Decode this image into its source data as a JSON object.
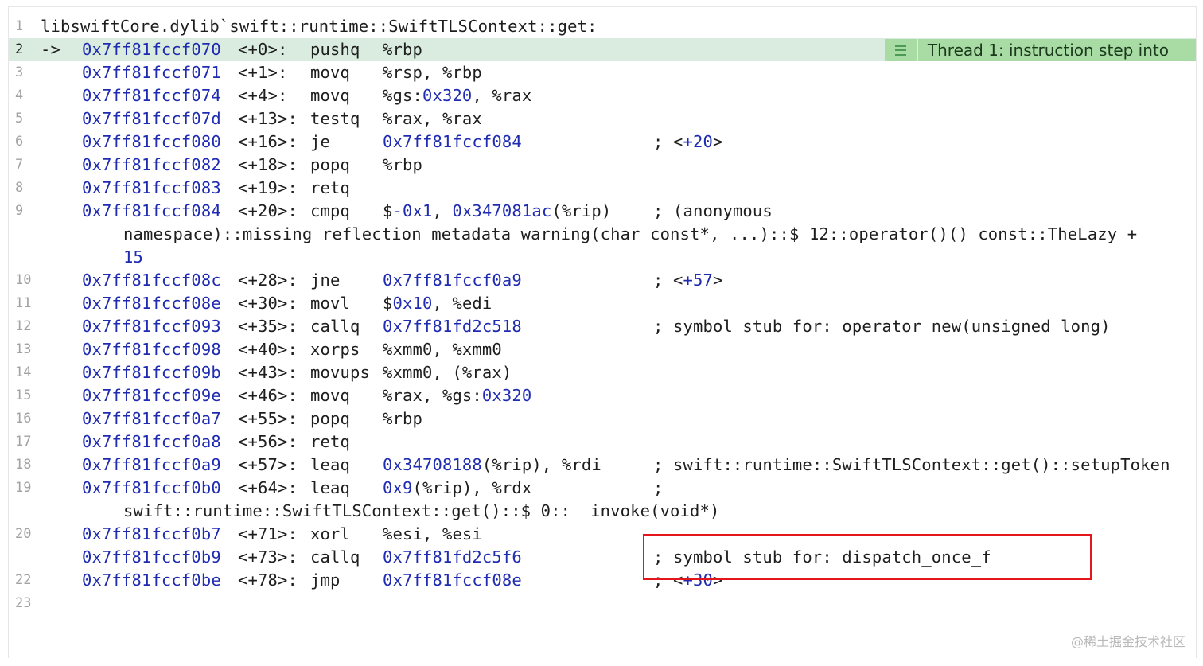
{
  "header": {
    "line_number": "1",
    "symbol": "libswiftCore.dylib`swift::runtime::SwiftTLSContext::get:"
  },
  "thread_badge": {
    "icon": "list-icon",
    "label": "Thread 1: instruction step into"
  },
  "pc_arrow": "->",
  "lines": [
    {
      "n": "2",
      "addr": "0x7ff81fccf070",
      "off": "<+0>:",
      "mn": "pushq",
      "ops": [
        {
          "t": "%rbp"
        }
      ]
    },
    {
      "n": "3",
      "addr": "0x7ff81fccf071",
      "off": "<+1>:",
      "mn": "movq",
      "ops": [
        {
          "t": "%rsp, %rbp"
        }
      ]
    },
    {
      "n": "4",
      "addr": "0x7ff81fccf074",
      "off": "<+4>:",
      "mn": "movq",
      "ops": [
        {
          "t": "%gs:"
        },
        {
          "t": "0x320",
          "hex": true
        },
        {
          "t": ", %rax"
        }
      ]
    },
    {
      "n": "5",
      "addr": "0x7ff81fccf07d",
      "off": "<+13>:",
      "mn": "testq",
      "ops": [
        {
          "t": "%rax, %rax"
        }
      ]
    },
    {
      "n": "6",
      "addr": "0x7ff81fccf080",
      "off": "<+16>:",
      "mn": "je",
      "ops": [
        {
          "t": "0x7ff81fccf084",
          "hex": true
        }
      ],
      "cmt": [
        {
          "t": "; <"
        },
        {
          "t": "+20",
          "hex": true
        },
        {
          "t": ">"
        }
      ]
    },
    {
      "n": "7",
      "addr": "0x7ff81fccf082",
      "off": "<+18>:",
      "mn": "popq",
      "ops": [
        {
          "t": "%rbp"
        }
      ]
    },
    {
      "n": "8",
      "addr": "0x7ff81fccf083",
      "off": "<+19>:",
      "mn": "retq",
      "ops": []
    },
    {
      "n": "9",
      "addr": "0x7ff81fccf084",
      "off": "<+20>:",
      "mn": "cmpq",
      "ops": [
        {
          "t": "$"
        },
        {
          "t": "-0x1",
          "hex": true
        },
        {
          "t": ", "
        },
        {
          "t": "0x347081ac",
          "hex": true
        },
        {
          "t": "(%rip)"
        }
      ],
      "cmt": [
        {
          "t": "; (anonymous"
        }
      ],
      "cont": [
        [
          {
            "t": "namespace)::missing_reflection_metadata_warning(char const*, ...)::$_12::operator()() const::TheLazy +"
          }
        ],
        [
          {
            "t": "15",
            "hex": true
          }
        ]
      ]
    },
    {
      "n": "10",
      "addr": "0x7ff81fccf08c",
      "off": "<+28>:",
      "mn": "jne",
      "ops": [
        {
          "t": "0x7ff81fccf0a9",
          "hex": true
        }
      ],
      "cmt": [
        {
          "t": "; <"
        },
        {
          "t": "+57",
          "hex": true
        },
        {
          "t": ">"
        }
      ]
    },
    {
      "n": "11",
      "addr": "0x7ff81fccf08e",
      "off": "<+30>:",
      "mn": "movl",
      "ops": [
        {
          "t": "$"
        },
        {
          "t": "0x10",
          "hex": true
        },
        {
          "t": ", %edi"
        }
      ]
    },
    {
      "n": "12",
      "addr": "0x7ff81fccf093",
      "off": "<+35>:",
      "mn": "callq",
      "ops": [
        {
          "t": "0x7ff81fd2c518",
          "hex": true
        }
      ],
      "cmt": [
        {
          "t": "; symbol stub for: operator new(unsigned long)"
        }
      ]
    },
    {
      "n": "13",
      "addr": "0x7ff81fccf098",
      "off": "<+40>:",
      "mn": "xorps",
      "ops": [
        {
          "t": "%xmm0, %xmm0"
        }
      ]
    },
    {
      "n": "14",
      "addr": "0x7ff81fccf09b",
      "off": "<+43>:",
      "mn": "movups",
      "ops": [
        {
          "t": "%xmm0, (%rax)"
        }
      ]
    },
    {
      "n": "15",
      "addr": "0x7ff81fccf09e",
      "off": "<+46>:",
      "mn": "movq",
      "ops": [
        {
          "t": "%rax, %gs:"
        },
        {
          "t": "0x320",
          "hex": true
        }
      ]
    },
    {
      "n": "16",
      "addr": "0x7ff81fccf0a7",
      "off": "<+55>:",
      "mn": "popq",
      "ops": [
        {
          "t": "%rbp"
        }
      ]
    },
    {
      "n": "17",
      "addr": "0x7ff81fccf0a8",
      "off": "<+56>:",
      "mn": "retq",
      "ops": []
    },
    {
      "n": "18",
      "addr": "0x7ff81fccf0a9",
      "off": "<+57>:",
      "mn": "leaq",
      "ops": [
        {
          "t": "0x34708188",
          "hex": true
        },
        {
          "t": "(%rip), %rdi"
        }
      ],
      "cmt": [
        {
          "t": "; swift::runtime::SwiftTLSContext::get()::setupToken"
        }
      ]
    },
    {
      "n": "19",
      "addr": "0x7ff81fccf0b0",
      "off": "<+64>:",
      "mn": "leaq",
      "ops": [
        {
          "t": "0x9",
          "hex": true
        },
        {
          "t": "(%rip), %rdx"
        }
      ],
      "cmt": [
        {
          "t": ";"
        }
      ],
      "cont": [
        [
          {
            "t": "swift::runtime::SwiftTLSContext::get()::$_0::__invoke(void*)"
          }
        ]
      ]
    },
    {
      "n": "20",
      "addr": "0x7ff81fccf0b7",
      "off": "<+71>:",
      "mn": "xorl",
      "ops": [
        {
          "t": "%esi, %esi"
        }
      ]
    },
    {
      "n": "",
      "addr": "0x7ff81fccf0b9",
      "off": "<+73>:",
      "mn": "callq",
      "ops": [
        {
          "t": "0x7ff81fd2c5f6",
          "hex": true
        }
      ],
      "cmt": [
        {
          "t": "; symbol stub for: dispatch_once_f"
        }
      ]
    },
    {
      "n": "22",
      "addr": "0x7ff81fccf0be",
      "off": "<+78>:",
      "mn": "jmp",
      "ops": [
        {
          "t": "0x7ff81fccf08e",
          "hex": true
        }
      ],
      "cmt": [
        {
          "t": "; <"
        },
        {
          "t": "+30",
          "hex": true
        },
        {
          "t": ">"
        }
      ]
    }
  ],
  "last_line_number": "23",
  "watermark": "@稀土掘金技术社区"
}
